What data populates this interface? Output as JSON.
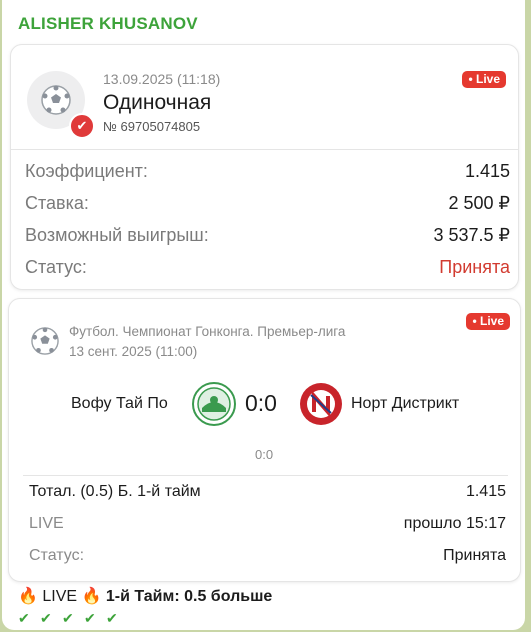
{
  "sender": "ALISHER KHUSANOV",
  "bet": {
    "date": "13.09.2025 (11:18)",
    "type": "Одиночная",
    "number": "№ 69705074805",
    "live_badge": "• Live",
    "rows": [
      {
        "label": "Коэффициент:",
        "value": "1.415"
      },
      {
        "label": "Ставка:",
        "value": "2 500 ₽"
      },
      {
        "label": "Возможный выигрыш:",
        "value": "3 537.5 ₽"
      },
      {
        "label": "Статус:",
        "value": "Принята"
      }
    ]
  },
  "event": {
    "league": "Футбол. Чемпионат Гонконга. Премьер-лига",
    "date": "13 сент. 2025 (11:00)",
    "live_badge": "• Live",
    "home_team": "Вофу Тай По",
    "away_team": "Норт Дистрикт",
    "score": "0:0",
    "sub_score": "0:0",
    "market": "Тотал. (0.5) Б. 1-й тайм",
    "market_odds": "1.415",
    "live_label": "LIVE",
    "elapsed": "прошло 15:17",
    "status_label": "Статус:",
    "status_value": "Принята"
  },
  "caption": {
    "live": "LIVE",
    "text": "1-й Тайм: 0.5 больше",
    "fire_icon": "🔥",
    "check_icon": "✔"
  },
  "colors": {
    "accent_green": "#3da33a",
    "live_red": "#e5392f",
    "status_red": "#d23b30",
    "background": "#c9d6a7"
  }
}
